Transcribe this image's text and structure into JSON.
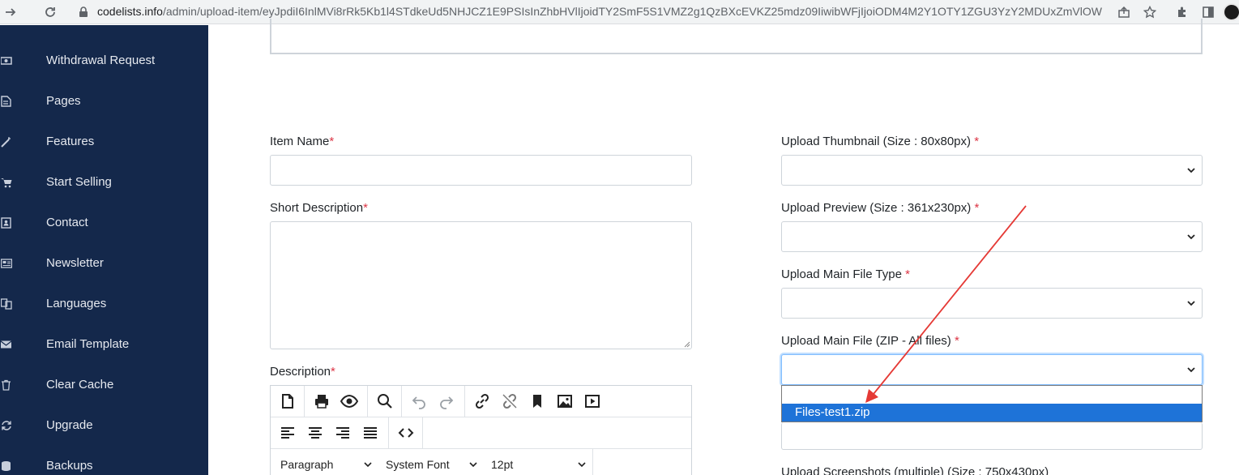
{
  "browser": {
    "url_host": "codelists.info",
    "url_path": "/admin/upload-item/eyJpdiI6InlMVi8rRk5Kb1l4STdkeUd5NHJCZ1E9PSIsInZhbHVlIjoidTY2SmF5S1VMZ2g1QzBXcEVKZ25mdz09IiwibWFjIjoiODM4M2Y1OTY1ZGU3YzY2MDUxZmVlOWVmN..."
  },
  "sidebar": {
    "items": [
      {
        "label": "Withdrawal Request",
        "icon": "money-icon"
      },
      {
        "label": "Pages",
        "icon": "file-icon"
      },
      {
        "label": "Features",
        "icon": "magic-icon"
      },
      {
        "label": "Start Selling",
        "icon": "cart-icon"
      },
      {
        "label": "Contact",
        "icon": "contact-book-icon"
      },
      {
        "label": "Newsletter",
        "icon": "newspaper-icon"
      },
      {
        "label": "Languages",
        "icon": "language-icon"
      },
      {
        "label": "Email Template",
        "icon": "envelope-icon"
      },
      {
        "label": "Clear Cache",
        "icon": "trash-icon"
      },
      {
        "label": "Upgrade",
        "icon": "sync-icon"
      },
      {
        "label": "Backups",
        "icon": "backup-icon"
      }
    ]
  },
  "form": {
    "item_name_label": "Item Name",
    "short_description_label": "Short Description",
    "description_label": "Description",
    "upload_thumbnail_label": "Upload Thumbnail (Size : 80x80px) ",
    "upload_preview_label": "Upload Preview (Size : 361x230px) ",
    "upload_main_file_type_label": "Upload Main File Type ",
    "upload_main_file_label": "Upload Main File (ZIP - All files) ",
    "upload_screenshots_label": "Upload Screenshots (multiple) (Size : 750x430px)",
    "required_mark": "*",
    "main_file_options": [
      "Files-test1.zip"
    ]
  },
  "editor": {
    "format_select": "Paragraph",
    "font_select": "System Font",
    "size_select": "12pt"
  },
  "colors": {
    "sidebar_bg": "#14284b",
    "required": "#dc3545",
    "option_highlight": "#1e73d8",
    "annotation_arrow": "#e53935"
  }
}
